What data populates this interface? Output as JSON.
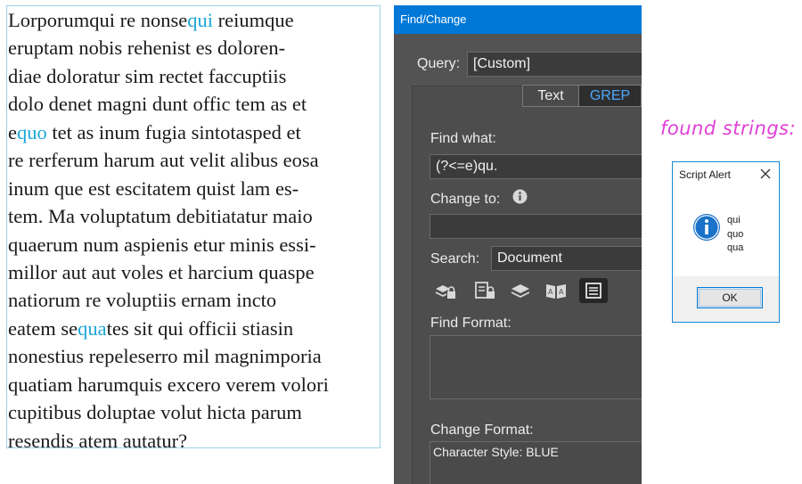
{
  "text_frame": {
    "lines": [
      {
        "pre": "Lorporumqui re nonse",
        "hl": "qui",
        "post": " reiumque"
      },
      {
        "pre": "eruptam nobis rehenist es doloren-",
        "hl": "",
        "post": ""
      },
      {
        "pre": "diae doloratur sim rectet faccuptiis",
        "hl": "",
        "post": ""
      },
      {
        "pre": "dolo denet magni dunt offic tem as et",
        "hl": "",
        "post": ""
      },
      {
        "pre": "e",
        "hl": "quo",
        "post": " tet as inum fugia sintotasped et"
      },
      {
        "pre": "re rerferum harum aut velit alibus eosa",
        "hl": "",
        "post": ""
      },
      {
        "pre": "inum que est escitatem quist lam es-",
        "hl": "",
        "post": ""
      },
      {
        "pre": "tem. Ma voluptatum debitiatatur maio",
        "hl": "",
        "post": ""
      },
      {
        "pre": "quaerum num aspienis etur minis essi-",
        "hl": "",
        "post": ""
      },
      {
        "pre": "millor aut aut voles et harcium quaspe",
        "hl": "",
        "post": ""
      },
      {
        "pre": "natiorum re voluptiis ernam incto",
        "hl": "",
        "post": ""
      },
      {
        "pre": "eatem se",
        "hl": "qua",
        "post": "tes sit qui officii stiasin"
      },
      {
        "pre": "nonestius repeleserro mil magnimporia",
        "hl": "",
        "post": ""
      },
      {
        "pre": "quatiam harumquis excero verem volori",
        "hl": "",
        "post": ""
      },
      {
        "pre": "cupitibus doluptae volut hicta parum",
        "hl": "",
        "post": ""
      },
      {
        "pre": "resendis atem autatur?",
        "hl": "",
        "post": ""
      }
    ],
    "highlight_color": "#1aa7d8"
  },
  "find_change": {
    "title": "Find/Change",
    "query_label": "Query:",
    "query_value": "[Custom]",
    "tabs": [
      "Text",
      "GREP"
    ],
    "active_tab": "GREP",
    "find_what_label": "Find what:",
    "find_what_value": "(?<=e)qu.",
    "change_to_label": "Change to:",
    "change_to_value": "",
    "search_label": "Search:",
    "search_value": "Document",
    "search_icons": [
      "locked-layers-icon",
      "locked-stories-icon",
      "hidden-layers-icon",
      "master-pages-icon",
      "footnotes-icon"
    ],
    "find_format_label": "Find Format:",
    "find_format_value": "",
    "change_format_label": "Change Format:",
    "change_format_value": "Character Style: BLUE",
    "title_bar_color": "#0078d7"
  },
  "annotation": {
    "text": "found strings:",
    "color": "#e040d8"
  },
  "script_alert": {
    "title": "Script Alert",
    "messages": [
      "qui",
      "quo",
      "qua"
    ],
    "ok_label": "OK",
    "icon": "info-icon"
  }
}
